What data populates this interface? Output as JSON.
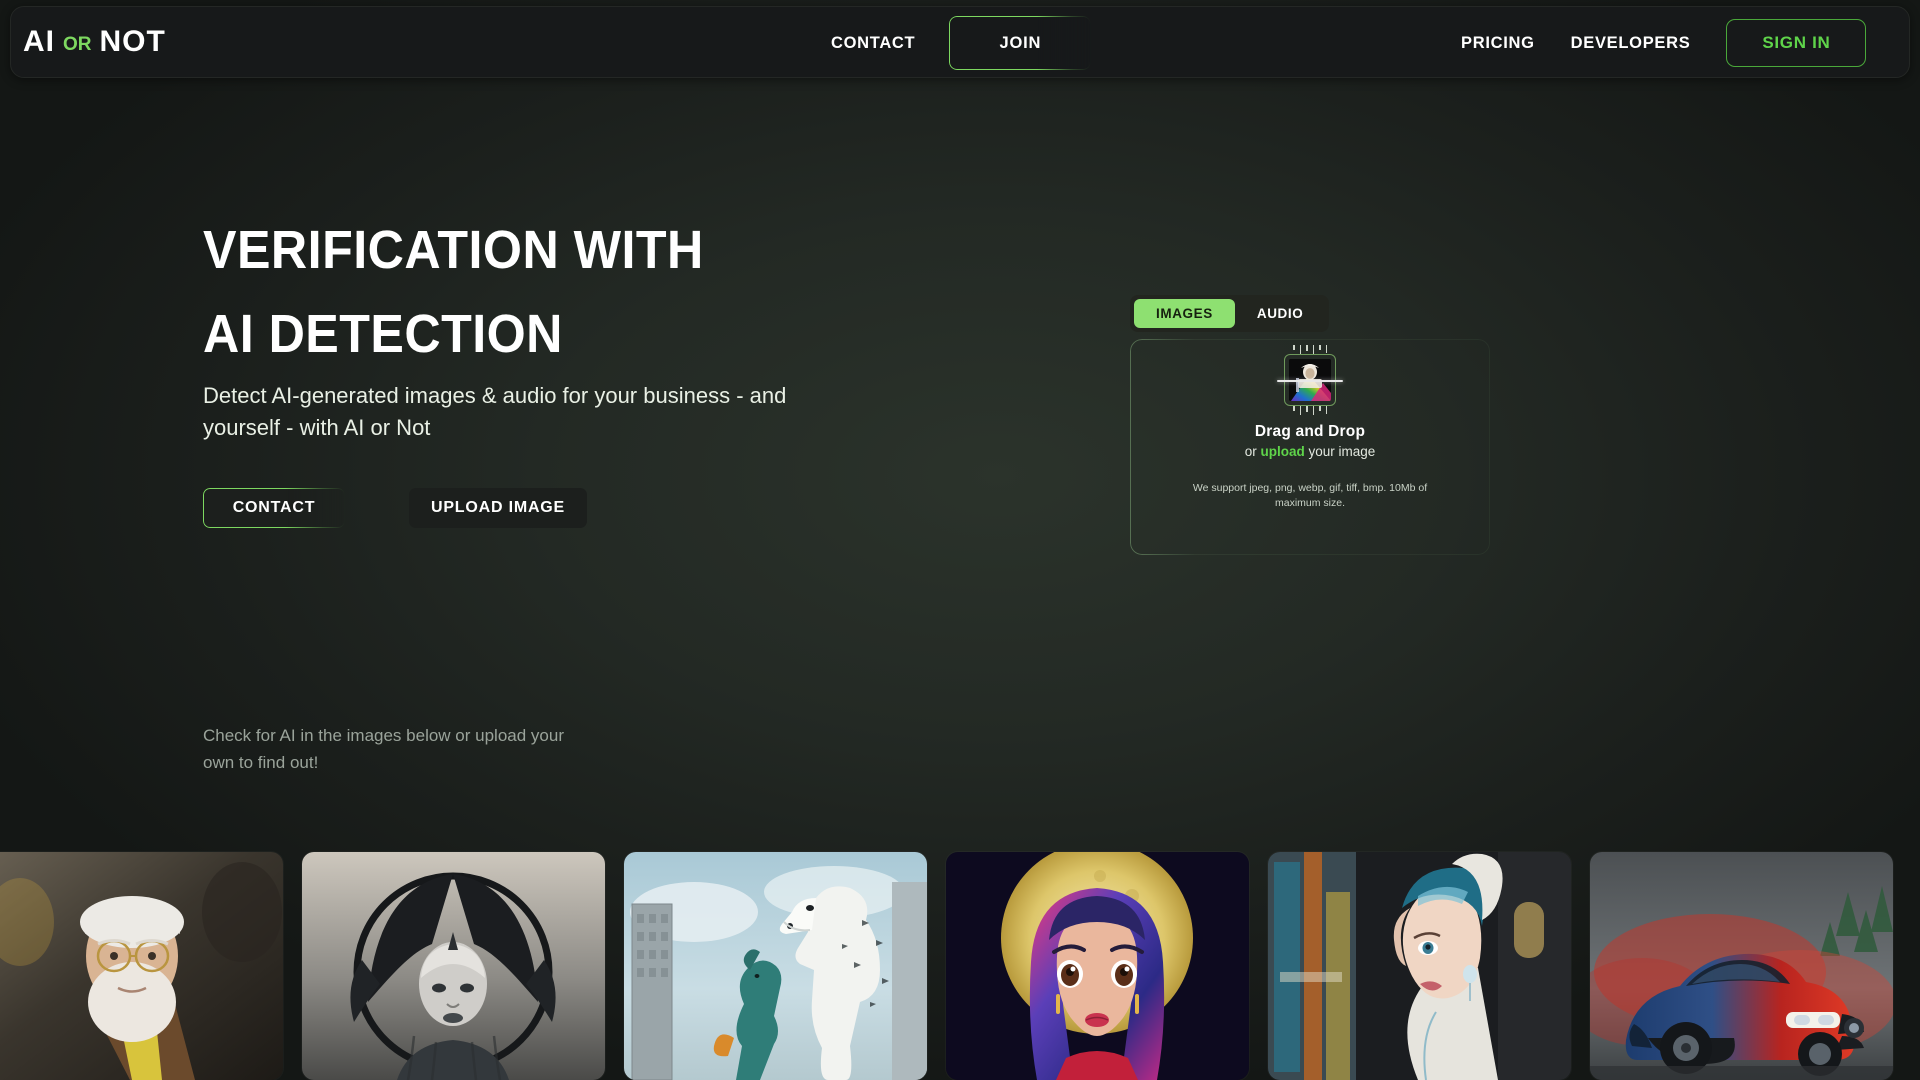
{
  "brand": {
    "word1": "AI",
    "or": "OR",
    "word2": "NOT"
  },
  "nav": {
    "contact": "CONTACT",
    "join": "JOIN",
    "pricing": "PRICING",
    "developers": "DEVELOPERS",
    "sign_in": "SIGN IN"
  },
  "hero": {
    "title_line1": "VERIFICATION WITH",
    "title_line2": "AI DETECTION",
    "subtitle": "Detect AI-generated images & audio for your business - and yourself - with AI or Not",
    "cta_contact": "CONTACT",
    "cta_upload": "UPLOAD IMAGE",
    "gallery_note": "Check for AI in the images below or upload your own to find out!"
  },
  "uploader": {
    "tabs": [
      {
        "label": "IMAGES",
        "active": true
      },
      {
        "label": "AUDIO",
        "active": false
      }
    ],
    "tab_images": "IMAGES",
    "tab_audio": "AUDIO",
    "drop_title": "Drag and Drop",
    "drop_sub_pre": "or ",
    "drop_sub_link": "upload",
    "drop_sub_post": " your image",
    "fine_print": "We support jpeg, png, webp, gif, tiff, bmp. 10Mb of maximum size."
  },
  "gallery": [
    {
      "name": "elderly-man-portrait",
      "alt": "Elderly man with white cap, round glasses and beard"
    },
    {
      "name": "biomech-winged-figure",
      "alt": "Monochrome biomechanical winged female figure"
    },
    {
      "name": "polar-bear-dinosaur-city",
      "alt": "Giant polar bear and dinosaur in a city"
    },
    {
      "name": "anime-girl-moon",
      "alt": "Anime girl with blue-pink hair in front of a golden moon"
    },
    {
      "name": "pearl-earring-remix",
      "alt": "Girl with a pearl earring modern remix"
    },
    {
      "name": "red-blue-sports-car",
      "alt": "Red and blue sports car with red smoke"
    }
  ],
  "colors": {
    "accent_green": "#8ee071",
    "link_green": "#5fd44a",
    "nav_bg": "#17191a",
    "page_bg": "#232924"
  }
}
